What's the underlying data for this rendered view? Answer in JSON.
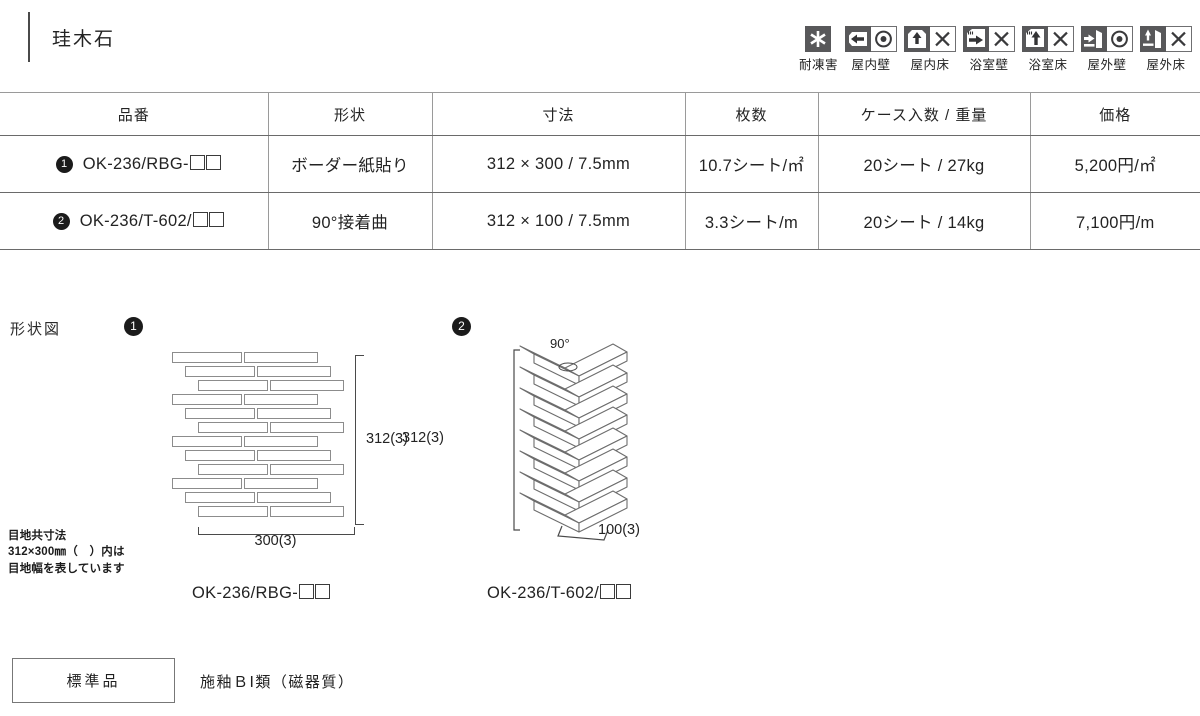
{
  "header": {
    "title": "珪木石",
    "badges": [
      {
        "label": "耐凍害",
        "icon": "frost-resistance-icon",
        "cells": [
          "snowflake"
        ]
      },
      {
        "label": "屋内壁",
        "icon": "indoor-wall-icon",
        "cells": [
          "arrow-left-wall",
          "double-circle"
        ]
      },
      {
        "label": "屋内床",
        "icon": "indoor-floor-icon",
        "cells": [
          "arrow-down-floor",
          "cross"
        ]
      },
      {
        "label": "浴室壁",
        "icon": "bathroom-wall-icon",
        "cells": [
          "shower-arrow-right",
          "cross"
        ]
      },
      {
        "label": "浴室床",
        "icon": "bathroom-floor-icon",
        "cells": [
          "shower-arrow-down",
          "cross"
        ]
      },
      {
        "label": "屋外壁",
        "icon": "outdoor-wall-icon",
        "cells": [
          "arrow-right-wall",
          "double-circle"
        ]
      },
      {
        "label": "屋外床",
        "icon": "outdoor-floor-icon",
        "cells": [
          "arrow-down-ground",
          "cross"
        ]
      }
    ]
  },
  "spec_table": {
    "columns": [
      "品番",
      "形状",
      "寸法",
      "枚数",
      "ケース入数 / 重量",
      "価格"
    ],
    "rows": [
      {
        "num": "1",
        "code_prefix": "OK-236/RBG-",
        "shape": "ボーダー紙貼り",
        "size": "312 × 300 / 7.5mm",
        "quantity": "10.7シート/㎡",
        "case": "20シート / 27kg",
        "price": "5,200円/㎡"
      },
      {
        "num": "2",
        "code_prefix": "OK-236/T-602/",
        "shape": "90°接着曲",
        "size": "312 × 100 / 7.5mm",
        "quantity": "3.3シート/m",
        "case": "20シート / 14kg",
        "price": "7,100円/m"
      }
    ]
  },
  "shape_section": {
    "label": "形状図",
    "figure1": {
      "num": "1",
      "dim_vertical": "312(3)",
      "dim_horizontal": "300(3)",
      "caption": "OK-236/RBG-"
    },
    "figure2": {
      "num": "2",
      "angle": "90°",
      "dim_vertical": "312(3)",
      "dim_horizontal": "100(3)",
      "caption": "OK-236/T-602/"
    },
    "note_lines": [
      "目地共寸法",
      "312×300㎜（　）内は",
      "目地幅を表しています"
    ]
  },
  "footer": {
    "standard_label": "標準品",
    "material_text": "施釉ＢⅠ類（磁器質）"
  },
  "colors": {
    "icon_dark": "#58585a",
    "rule": "#6a6a6a",
    "text": "#232323"
  }
}
